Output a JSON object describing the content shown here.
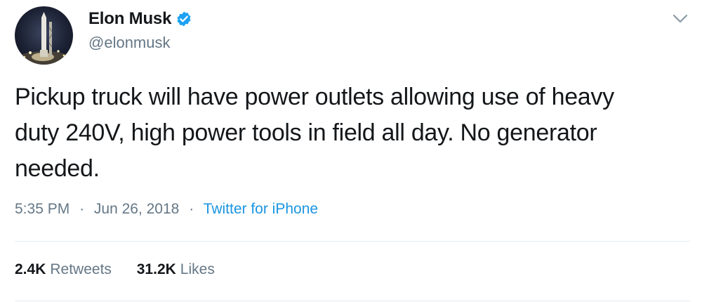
{
  "author": {
    "display_name": "Elon Musk",
    "handle": "@elonmusk",
    "verified": true,
    "avatar_icon": "avatar-rocket-launchpad-night"
  },
  "tweet": {
    "text": "Pickup truck will have power outlets allowing use of heavy\nduty 240V, high power tools in field all day. No generator\nneeded."
  },
  "meta": {
    "time": "5:35 PM",
    "date": "Jun 26, 2018",
    "separator": "·",
    "source": "Twitter for iPhone"
  },
  "stats": {
    "retweets_count": "2.4K",
    "retweets_label": "Retweets",
    "likes_count": "31.2K",
    "likes_label": "Likes"
  },
  "icons": {
    "verified": "verified-badge-icon",
    "menu": "chevron-down-icon"
  },
  "colors": {
    "text": "#14171a",
    "secondary": "#657786",
    "link": "#1b95e0",
    "verified": "#1da1f2",
    "divider": "#e6ecf0"
  }
}
